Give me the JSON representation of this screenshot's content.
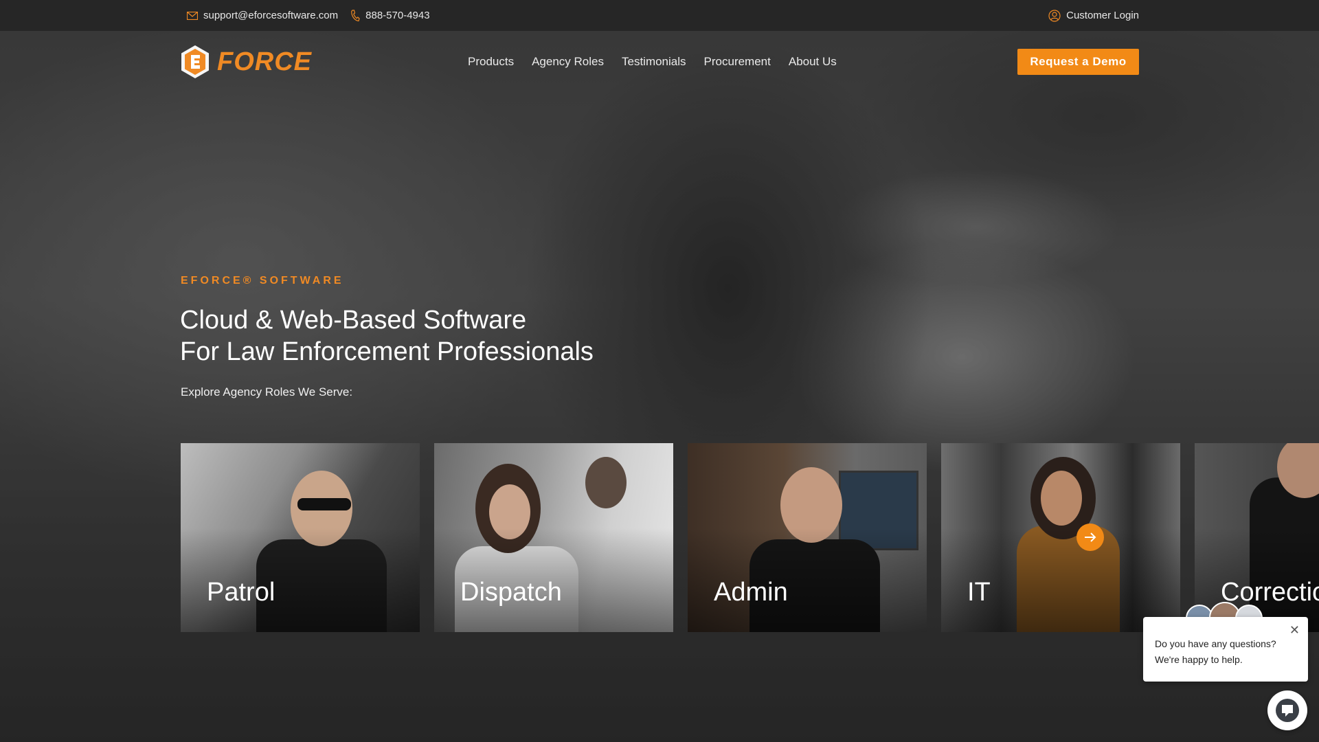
{
  "topbar": {
    "email": "support@eforcesoftware.com",
    "phone": "888-570-4943",
    "login": "Customer Login"
  },
  "brand": {
    "logo_text": "FORCE",
    "accent": "#f28a16"
  },
  "nav": {
    "items": [
      "Products",
      "Agency Roles",
      "Testimonials",
      "Procurement",
      "About Us"
    ],
    "cta": "Request a Demo"
  },
  "hero": {
    "eyebrow": "EFORCE® SOFTWARE",
    "headline_1": "Cloud & Web-Based Software",
    "headline_2": "For Law Enforcement Professionals",
    "subline": "Explore Agency Roles We Serve:"
  },
  "roles": [
    {
      "label": "Patrol"
    },
    {
      "label": "Dispatch"
    },
    {
      "label": "Admin"
    },
    {
      "label": "IT"
    },
    {
      "label": "Correctio"
    }
  ],
  "chat": {
    "line1": "Do you have any questions?",
    "line2": "We're happy to help."
  }
}
